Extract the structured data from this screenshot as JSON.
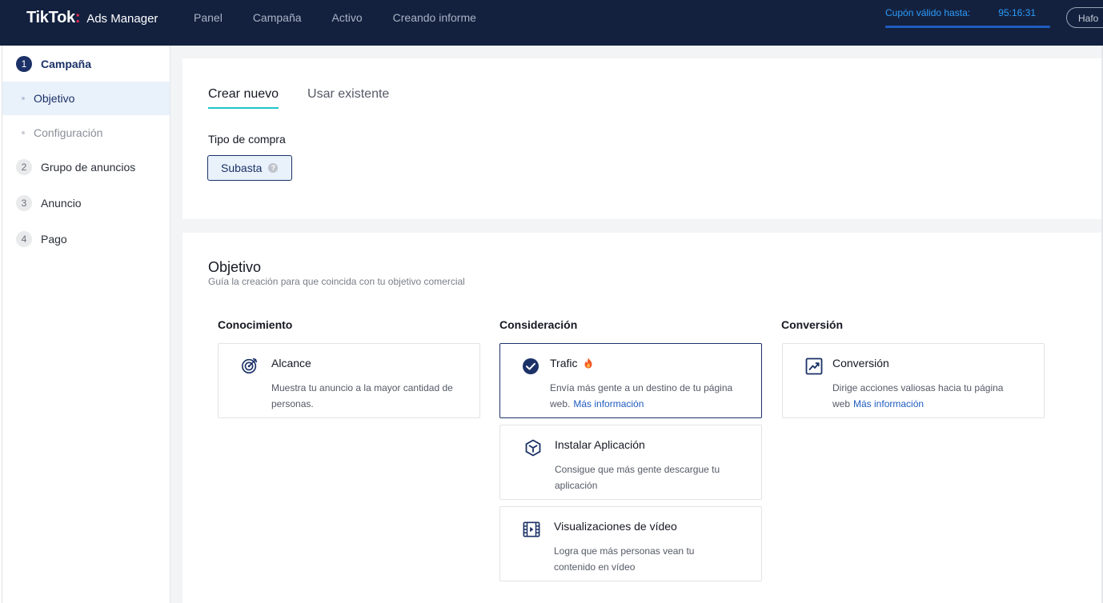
{
  "header": {
    "brand": "TikTok",
    "brand_sub": "Ads Manager",
    "nav": [
      "Panel",
      "Campaña",
      "Activo",
      "Creando informe"
    ],
    "coupon_label": "Cupón válido hasta:",
    "coupon_time": "95:16:31",
    "coupon_progress": 1.0,
    "user_button": "Hafo"
  },
  "sidebar": {
    "steps": [
      {
        "num": "1",
        "label": "Campaña"
      },
      {
        "num": "2",
        "label": "Grupo de anuncios"
      },
      {
        "num": "3",
        "label": "Anuncio"
      },
      {
        "num": "4",
        "label": "Pago"
      }
    ],
    "substeps": [
      "Objetivo",
      "Configuración"
    ]
  },
  "purchase": {
    "tabs": [
      "Crear nuevo",
      "Usar existente"
    ],
    "type_label": "Tipo de compra",
    "type_value": "Subasta"
  },
  "objective": {
    "title": "Objetivo",
    "subtitle": "Guía la creación para que coincida con tu objetivo comercial",
    "columns": [
      "Conocimiento",
      "Consideración",
      "Conversión"
    ],
    "options": {
      "alcance": {
        "title": "Alcance",
        "desc": "Muestra tu anuncio a la mayor cantidad de personas."
      },
      "trafic": {
        "title": "Trafic",
        "desc": "Envía más gente a un destino de tu página web.",
        "link": "Más información"
      },
      "app": {
        "title": "Instalar Aplicación",
        "desc": "Consigue que más gente descargue tu aplicación"
      },
      "video": {
        "title": "Visualizaciones de vídeo",
        "desc": "Logra que más personas vean tu contenido en vídeo"
      },
      "conversion": {
        "title": "Conversión",
        "desc": "Dirige acciones valiosas hacia tu página web",
        "link": "Más información"
      }
    }
  },
  "colors": {
    "navy": "#13213f",
    "accent": "#1b3167",
    "teal": "#21c4c8",
    "link": "#1f5cbf"
  }
}
